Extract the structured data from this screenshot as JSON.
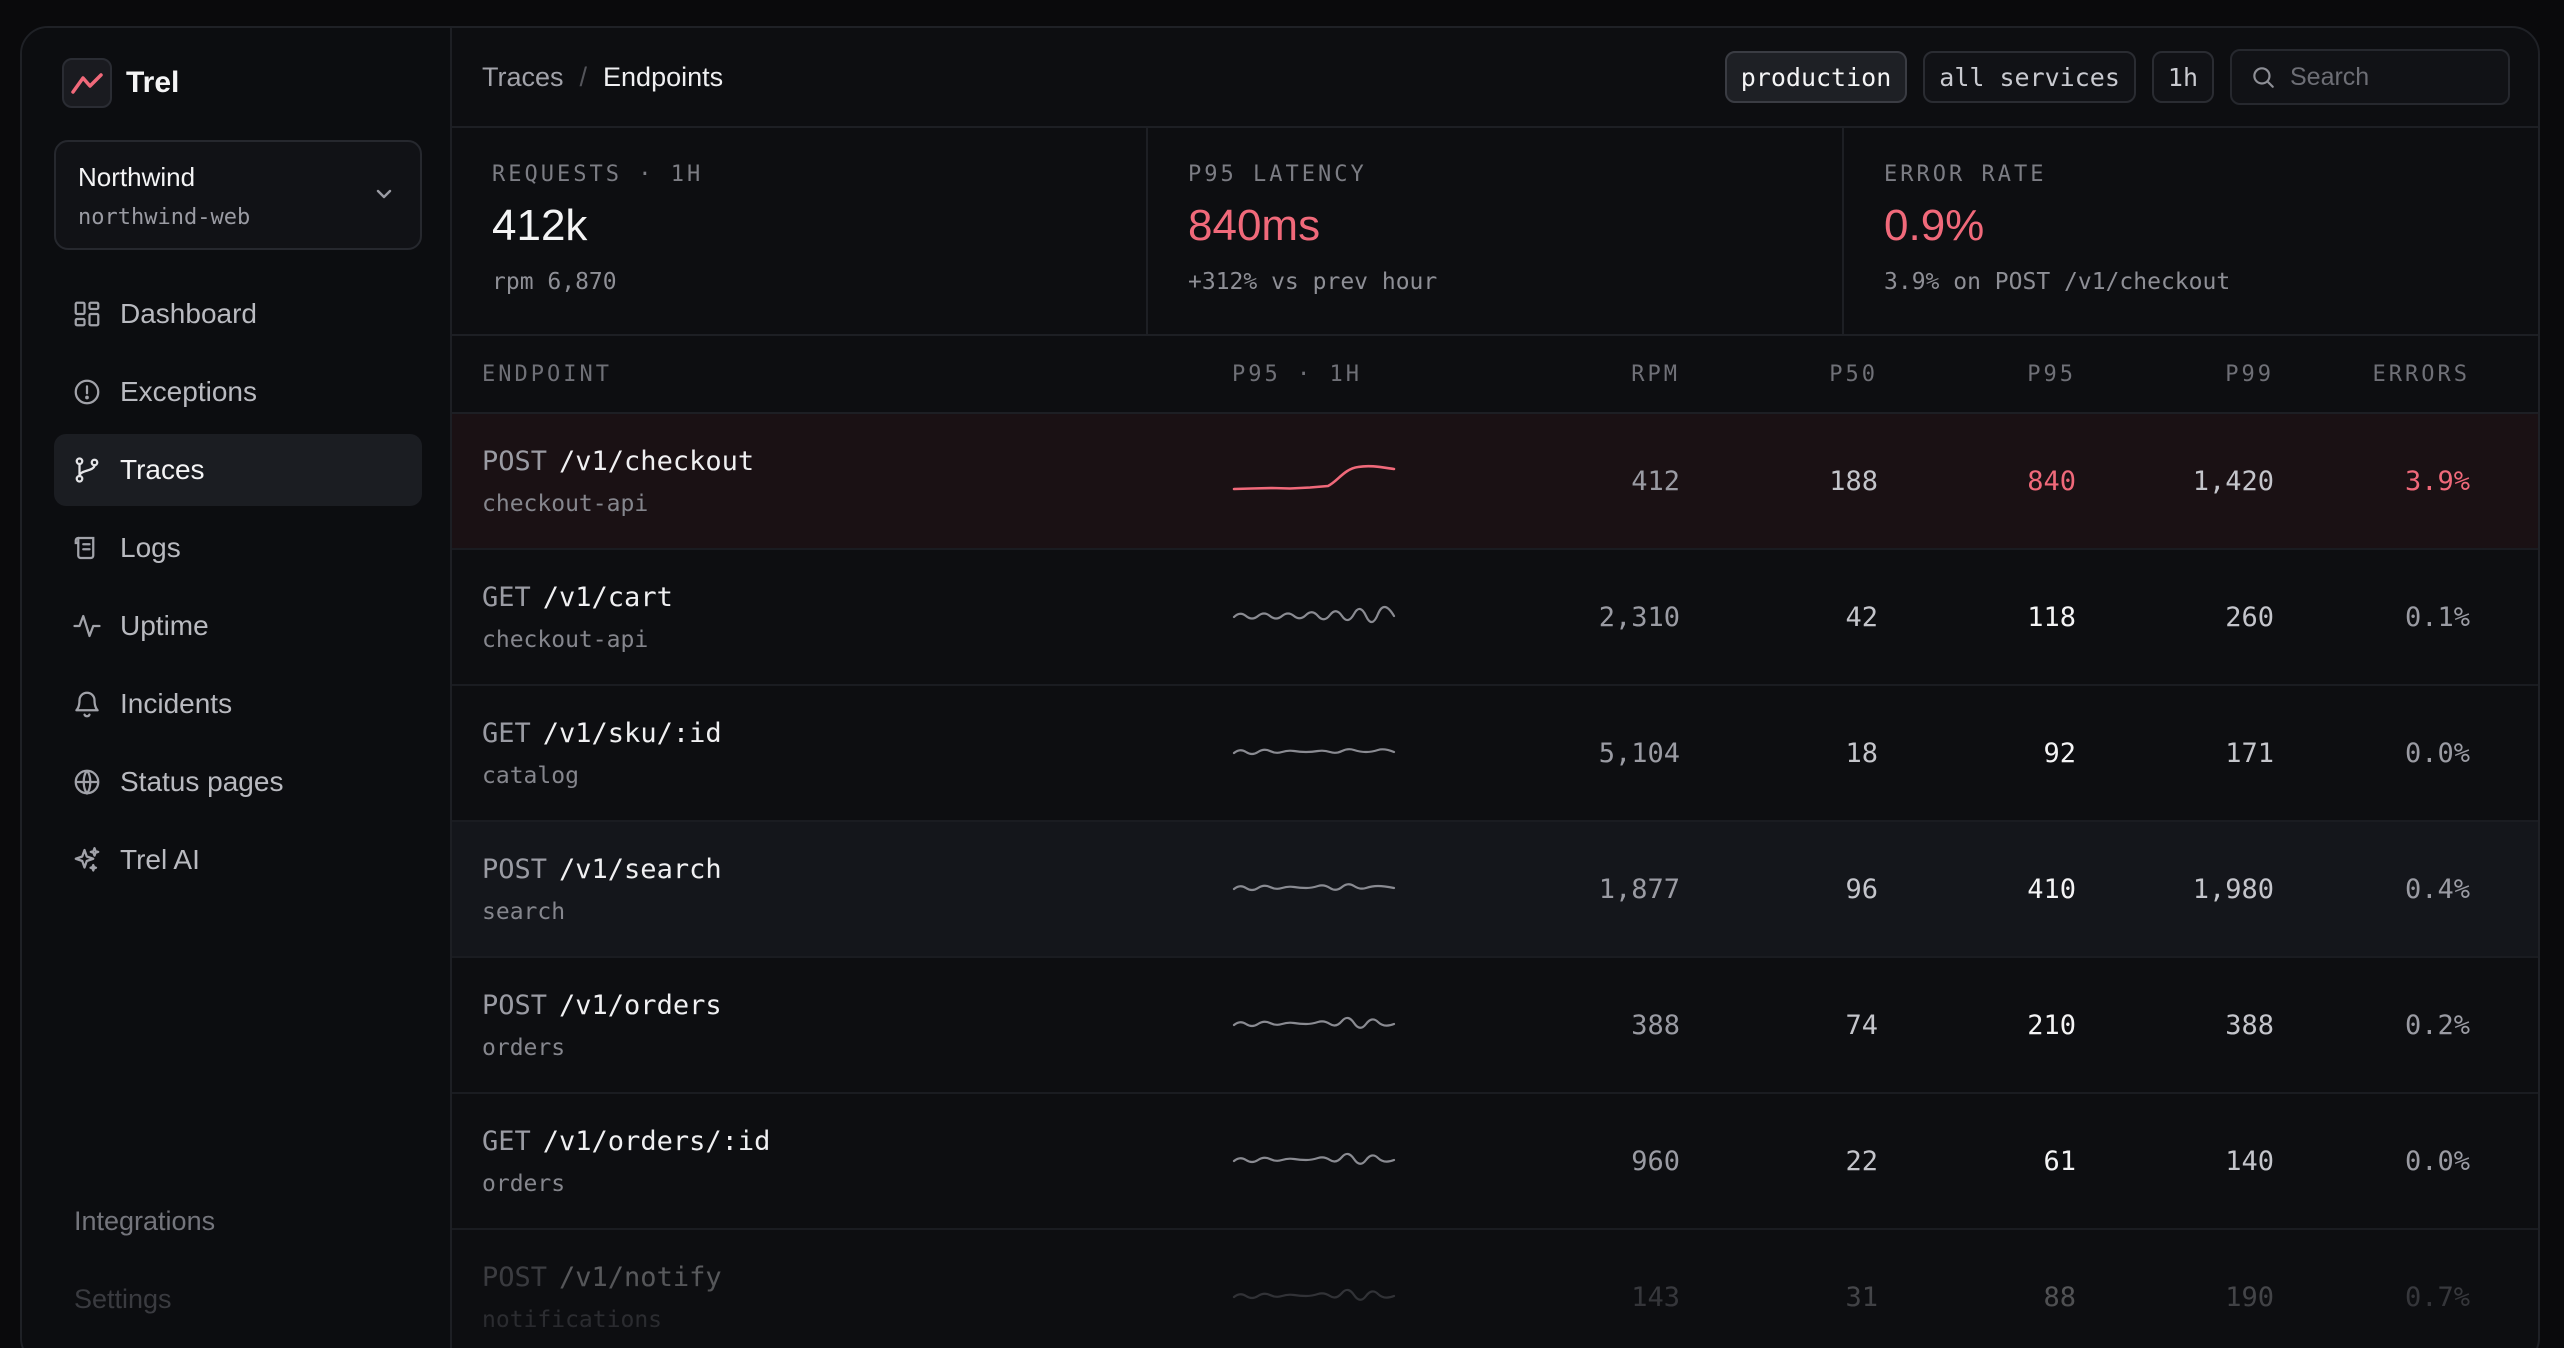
{
  "brand": {
    "name": "Trel",
    "accent": "#f0697a"
  },
  "project": {
    "name": "Northwind",
    "slug": "northwind-web"
  },
  "nav": [
    {
      "label": "Dashboard",
      "icon": "dashboard-icon"
    },
    {
      "label": "Exceptions",
      "icon": "alert-circle-icon"
    },
    {
      "label": "Traces",
      "icon": "git-branch-icon",
      "active": true
    },
    {
      "label": "Logs",
      "icon": "scroll-icon"
    },
    {
      "label": "Uptime",
      "icon": "activity-icon"
    },
    {
      "label": "Incidents",
      "icon": "bell-icon"
    },
    {
      "label": "Status pages",
      "icon": "globe-icon"
    },
    {
      "label": "Trel AI",
      "icon": "sparkles-icon"
    }
  ],
  "sidebar_footer": {
    "integrations": "Integrations",
    "settings": "Settings"
  },
  "breadcrumb": {
    "parent": "Traces",
    "separator": "/",
    "current": "Endpoints"
  },
  "filters": {
    "env": "production",
    "services": "all services",
    "range": "1h"
  },
  "search": {
    "placeholder": "Search"
  },
  "stats": [
    {
      "label": "REQUESTS · 1H",
      "value": "412k",
      "sub": "rpm 6,870",
      "tone": "normal"
    },
    {
      "label": "P95 LATENCY",
      "value": "840ms",
      "sub": "+312% vs prev hour",
      "tone": "danger"
    },
    {
      "label": "ERROR RATE",
      "value": "0.9%",
      "sub": "3.9% on POST /v1/checkout",
      "tone": "danger"
    }
  ],
  "table": {
    "headers": {
      "endpoint": "ENDPOINT",
      "spark": "P95 · 1H",
      "rpm": "RPM",
      "p50": "P50",
      "p95": "P95",
      "p99": "P99",
      "errors": "ERRORS"
    },
    "rows": [
      {
        "method": "POST",
        "path": "/v1/checkout",
        "service": "checkout-api",
        "rpm": "412",
        "p50": "188",
        "p95": "840",
        "p99": "1,420",
        "errors": "3.9%",
        "state": "hot"
      },
      {
        "method": "GET",
        "path": "/v1/cart",
        "service": "checkout-api",
        "rpm": "2,310",
        "p50": "42",
        "p95": "118",
        "p99": "260",
        "errors": "0.1%",
        "state": "normal"
      },
      {
        "method": "GET",
        "path": "/v1/sku/:id",
        "service": "catalog",
        "rpm": "5,104",
        "p50": "18",
        "p95": "92",
        "p99": "171",
        "errors": "0.0%",
        "state": "normal"
      },
      {
        "method": "POST",
        "path": "/v1/search",
        "service": "search",
        "rpm": "1,877",
        "p50": "96",
        "p95": "410",
        "p99": "1,980",
        "errors": "0.4%",
        "state": "hover"
      },
      {
        "method": "POST",
        "path": "/v1/orders",
        "service": "orders",
        "rpm": "388",
        "p50": "74",
        "p95": "210",
        "p99": "388",
        "errors": "0.2%",
        "state": "normal"
      },
      {
        "method": "GET",
        "path": "/v1/orders/:id",
        "service": "orders",
        "rpm": "960",
        "p50": "22",
        "p95": "61",
        "p99": "140",
        "errors": "0.0%",
        "state": "normal"
      },
      {
        "method": "POST",
        "path": "/v1/notify",
        "service": "notifications",
        "rpm": "143",
        "p50": "31",
        "p95": "88",
        "p99": "190",
        "errors": "0.7%",
        "state": "faded"
      }
    ]
  }
}
